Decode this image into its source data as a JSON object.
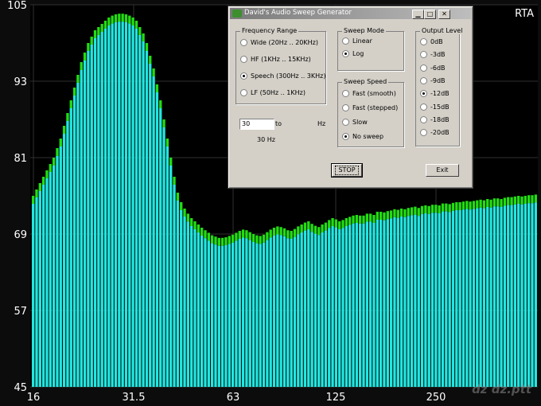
{
  "rta": {
    "title": "RTA",
    "watermark": "dz dz.ptt"
  },
  "chart_data": {
    "type": "bar",
    "y_ticks": [
      105,
      93,
      81,
      69,
      57,
      45
    ],
    "ylim": [
      45,
      105
    ],
    "x_ticks": [
      "16",
      "31.5",
      "63",
      "125",
      "250"
    ],
    "colors": {
      "bar": "#22e6e0",
      "peak": "#22dd11",
      "background": "#000000",
      "grid": "#303030"
    },
    "values": [
      75,
      76,
      77,
      78,
      79,
      80,
      81,
      82.5,
      84,
      86,
      88,
      90,
      92,
      94,
      96,
      97.5,
      99,
      100,
      101,
      101.5,
      102,
      102.5,
      103,
      103.3,
      103.5,
      103.6,
      103.6,
      103.5,
      103.3,
      103,
      102.5,
      101.5,
      100.5,
      99,
      97,
      95,
      92.5,
      90,
      87,
      84,
      81,
      78,
      75.5,
      74,
      73,
      72.2,
      71.5,
      71,
      70.5,
      70,
      69.6,
      69.2,
      68.8,
      68.6,
      68.4,
      68.4,
      68.5,
      68.7,
      68.9,
      69.2,
      69.5,
      69.7,
      69.6,
      69.3,
      69,
      68.8,
      68.7,
      68.9,
      69.3,
      69.7,
      70,
      70.2,
      70.1,
      69.9,
      69.6,
      69.5,
      69.8,
      70.2,
      70.5,
      70.8,
      71,
      70.6,
      70.3,
      70.1,
      70.5,
      70.8,
      71.2,
      71.5,
      71.3,
      71,
      71.2,
      71.5,
      71.7,
      71.9,
      72,
      71.9,
      71.9,
      72.2,
      72.2,
      72,
      72.5,
      72.5,
      72.4,
      72.6,
      72.7,
      72.9,
      72.8,
      73,
      72.9,
      73.1,
      73.2,
      73.3,
      73.1,
      73.4,
      73.5,
      73.4,
      73.6,
      73.6,
      73.5,
      73.8,
      73.8,
      73.7,
      73.9,
      74,
      74,
      74.1,
      74.2,
      74.1,
      74.2,
      74.3,
      74.4,
      74.3,
      74.5,
      74.4,
      74.6,
      74.6,
      74.5,
      74.7,
      74.8,
      74.8,
      74.9,
      75,
      74.9,
      75,
      75.1,
      75.1,
      75.2
    ]
  },
  "dialog": {
    "title": "David's Audio Sweep Generator",
    "min_glyph": "▁",
    "max_glyph": "□",
    "close_glyph": "✕",
    "frequency_range": {
      "label": "Frequency Range",
      "options": [
        {
          "label": "Wide (20Hz .. 20KHz)",
          "selected": false
        },
        {
          "label": "HF (1KHz .. 15KHz)",
          "selected": false
        },
        {
          "label": "Speech (300Hz .. 3KHz)",
          "selected": true
        },
        {
          "label": "LF (50Hz .. 1KHz)",
          "selected": false
        }
      ]
    },
    "sweep_mode": {
      "label": "Sweep Mode",
      "options": [
        {
          "label": "Linear",
          "selected": false
        },
        {
          "label": "Log",
          "selected": true
        }
      ]
    },
    "sweep_speed": {
      "label": "Sweep Speed",
      "options": [
        {
          "label": "Fast (smooth)",
          "selected": false
        },
        {
          "label": "Fast (stepped)",
          "selected": false
        },
        {
          "label": "Slow",
          "selected": false
        },
        {
          "label": "No sweep",
          "selected": true
        }
      ]
    },
    "output_level": {
      "label": "Output Level",
      "options": [
        {
          "label": "0dB",
          "selected": false
        },
        {
          "label": "-3dB",
          "selected": false
        },
        {
          "label": "-6dB",
          "selected": false
        },
        {
          "label": "-9dB",
          "selected": false
        },
        {
          "label": "-12dB",
          "selected": true
        },
        {
          "label": "-15dB",
          "selected": false
        },
        {
          "label": "-18dB",
          "selected": false
        },
        {
          "label": "-20dB",
          "selected": false
        }
      ]
    },
    "frequency_input": {
      "value": "30",
      "to_label": "to",
      "unit_label": "Hz",
      "readout": "30 Hz"
    },
    "stop_label": "STOP",
    "exit_label": "Exit"
  }
}
